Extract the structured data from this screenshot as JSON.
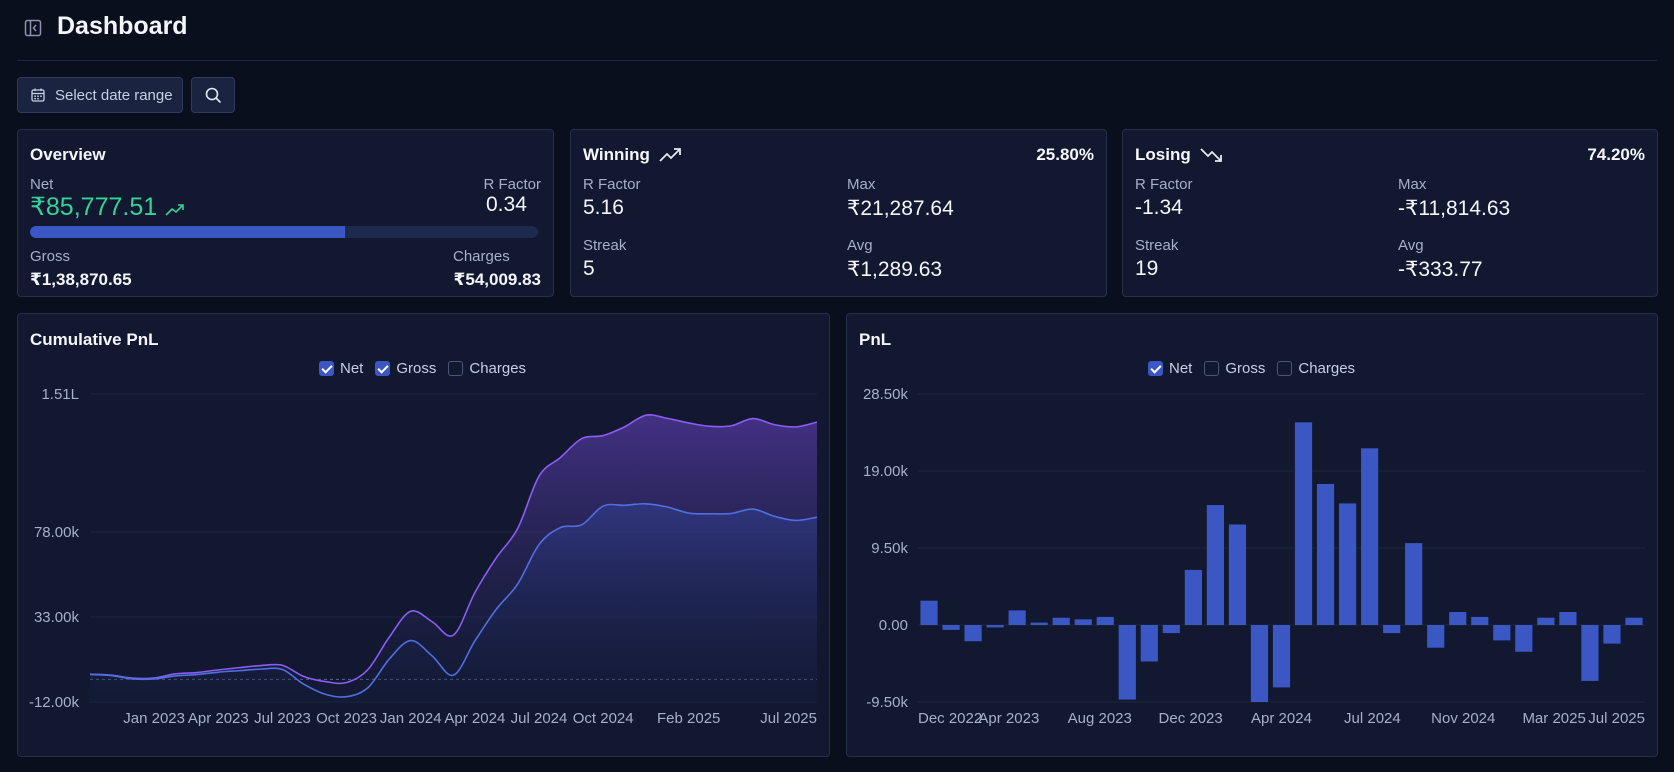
{
  "header": {
    "title": "Dashboard"
  },
  "toolbar": {
    "date_label": "Select date range"
  },
  "overview": {
    "title": "Overview",
    "net_label": "Net",
    "net_value": "₹85,777.51",
    "r_factor_label": "R Factor",
    "r_factor_value": "0.34",
    "net_share": 0.62,
    "gross_label": "Gross",
    "gross_value": "₹1,38,870.65",
    "charges_label": "Charges",
    "charges_value": "₹54,009.83",
    "colors": {
      "positive": "#34d399",
      "bar": "#3b57c4"
    }
  },
  "winning": {
    "title": "Winning",
    "percent": "25.80%",
    "r_factor_label": "R Factor",
    "r_factor_value": "5.16",
    "max_label": "Max",
    "max_value": "₹21,287.64",
    "streak_label": "Streak",
    "streak_value": "5",
    "avg_label": "Avg",
    "avg_value": "₹1,289.63",
    "icon": "trending-up-icon"
  },
  "losing": {
    "title": "Losing",
    "percent": "74.20%",
    "r_factor_label": "R Factor",
    "r_factor_value": "-1.34",
    "max_label": "Max",
    "max_value": "-₹11,814.63",
    "streak_label": "Streak",
    "streak_value": "19",
    "avg_label": "Avg",
    "avg_value": "-₹333.77",
    "icon": "trending-down-icon"
  },
  "cumulative": {
    "title": "Cumulative PnL",
    "legend": [
      {
        "label": "Net",
        "checked": true
      },
      {
        "label": "Gross",
        "checked": true
      },
      {
        "label": "Charges",
        "checked": false
      }
    ]
  },
  "pnl": {
    "title": "PnL",
    "legend": [
      {
        "label": "Net",
        "checked": true
      },
      {
        "label": "Gross",
        "checked": false
      },
      {
        "label": "Charges",
        "checked": false
      }
    ]
  },
  "chart_data": [
    {
      "type": "area",
      "title": "Cumulative PnL",
      "xlabel": "",
      "ylabel": "",
      "y_ticks": [
        "1.51L",
        "78.00k",
        "33.00k",
        "-12.00k"
      ],
      "y_tick_values": [
        151000,
        78000,
        33000,
        -12000
      ],
      "ylim": [
        -12000,
        151000
      ],
      "x_ticks": [
        "Jan 2023",
        "Apr 2023",
        "Jul 2023",
        "Oct 2023",
        "Jan 2024",
        "Apr 2024",
        "Jul 2024",
        "Oct 2024",
        "Feb 2025",
        "Jul 2025"
      ],
      "x": [
        "Oct 2022",
        "Nov 2022",
        "Dec 2022",
        "Jan 2023",
        "Feb 2023",
        "Mar 2023",
        "Apr 2023",
        "May 2023",
        "Jun 2023",
        "Jul 2023",
        "Aug 2023",
        "Sep 2023",
        "Oct 2023",
        "Nov 2023",
        "Dec 2023",
        "Jan 2024",
        "Feb 2024",
        "Mar 2024",
        "Apr 2024",
        "May 2024",
        "Jun 2024",
        "Jul 2024",
        "Aug 2024",
        "Sep 2024",
        "Oct 2024",
        "Nov 2024",
        "Dec 2024",
        "Jan 2025",
        "Feb 2025",
        "Mar 2025",
        "Apr 2025",
        "May 2025",
        "Jun 2025",
        "Jul 2025",
        "Aug 2025"
      ],
      "series": [
        {
          "name": "Net",
          "color": "#4f6fe0",
          "values": [
            2600,
            2000,
            200,
            200,
            1800,
            2500,
            3800,
            4600,
            5400,
            5200,
            -2600,
            -7900,
            -9200,
            -4400,
            10800,
            20500,
            12400,
            2200,
            20300,
            37100,
            50400,
            71300,
            80300,
            81800,
            91700,
            92100,
            92900,
            91200,
            88000,
            87600,
            87800,
            90100,
            86300,
            84100,
            85800
          ]
        },
        {
          "name": "Gross",
          "color": "#8b5cf6",
          "values": [
            2700,
            2200,
            600,
            700,
            2900,
            3600,
            5000,
            6200,
            7300,
            7400,
            1500,
            -1200,
            -1700,
            5200,
            22400,
            36000,
            30500,
            23400,
            45900,
            64300,
            79800,
            107500,
            117400,
            127400,
            129000,
            133600,
            139800,
            138100,
            135700,
            133900,
            134200,
            138000,
            134800,
            133600,
            136100
          ]
        }
      ]
    },
    {
      "type": "bar",
      "title": "PnL",
      "xlabel": "",
      "ylabel": "",
      "y_ticks": [
        "28.50k",
        "19.00k",
        "9.50k",
        "0.00",
        "-9.50k"
      ],
      "y_tick_values": [
        28500,
        19000,
        9500,
        0,
        -9500
      ],
      "ylim": [
        -9500,
        28500
      ],
      "x_ticks": [
        "Dec 2022",
        "Apr 2023",
        "Aug 2023",
        "Dec 2023",
        "Apr 2024",
        "Jul 2024",
        "Nov 2024",
        "Mar 2025",
        "Jul 2025"
      ],
      "series": [
        {
          "name": "Net",
          "color": "#3b57c4",
          "values": [
            3000,
            -600,
            -2000,
            -300,
            1800,
            300,
            900,
            700,
            1000,
            -9200,
            -4500,
            -1000,
            6800,
            14800,
            12400,
            -9500,
            -7700,
            25000,
            17400,
            15000,
            21800,
            -1000,
            10100,
            -2800,
            1600,
            1000,
            -1900,
            -3300,
            900,
            1600,
            -6900,
            -2300,
            900
          ]
        }
      ]
    }
  ]
}
